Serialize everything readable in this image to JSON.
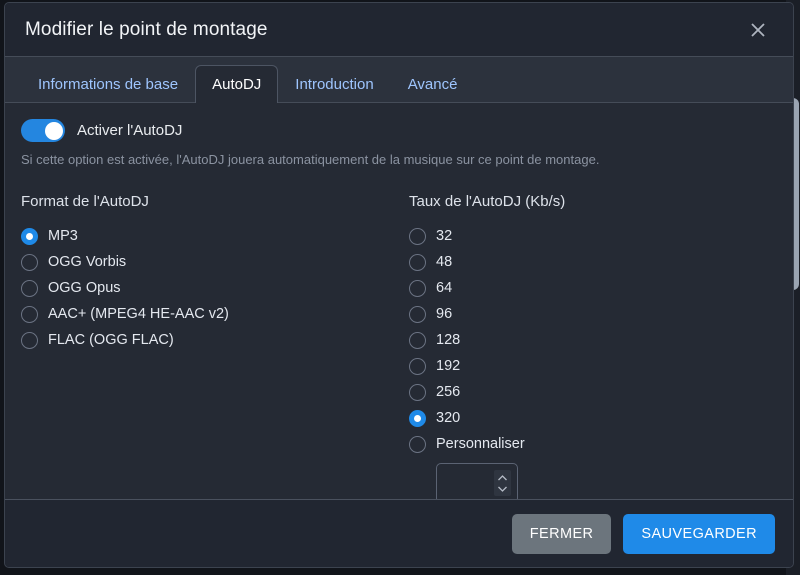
{
  "colors": {
    "accent": "#1f8ae8",
    "toggle_on": "#2486e0",
    "modal_bg": "#252a34",
    "header_bg": "#212631",
    "tabstrip_bg": "#2c323d",
    "secondary_button": "#6c757d",
    "muted_text": "#8b93a1",
    "tab_link": "#9ec5fe"
  },
  "header": {
    "title": "Modifier le point de montage",
    "close_icon": "close-icon"
  },
  "tabs": [
    {
      "label": "Informations de base",
      "active": false
    },
    {
      "label": "AutoDJ",
      "active": true
    },
    {
      "label": "Introduction",
      "active": false
    },
    {
      "label": "Avancé",
      "active": false
    }
  ],
  "body": {
    "toggle": {
      "label": "Activer l'AutoDJ",
      "enabled": true
    },
    "help_text": "Si cette option est activée, l'AutoDJ jouera automatiquement de la musique sur ce point de montage.",
    "format_group": {
      "label": "Format de l'AutoDJ",
      "selected": "MP3",
      "options": [
        "MP3",
        "OGG Vorbis",
        "OGG Opus",
        "AAC+ (MPEG4 HE-AAC v2)",
        "FLAC (OGG FLAC)"
      ]
    },
    "bitrate_group": {
      "label": "Taux de l'AutoDJ (Kb/s)",
      "selected": "320",
      "options": [
        "32",
        "48",
        "64",
        "96",
        "128",
        "192",
        "256",
        "320",
        "Personnaliser"
      ],
      "custom_input": {
        "value": "",
        "placeholder": "",
        "stepper_icon": "spinner-arrows-icon"
      }
    }
  },
  "footer": {
    "close_label": "FERMER",
    "save_label": "SAUVEGARDER"
  }
}
